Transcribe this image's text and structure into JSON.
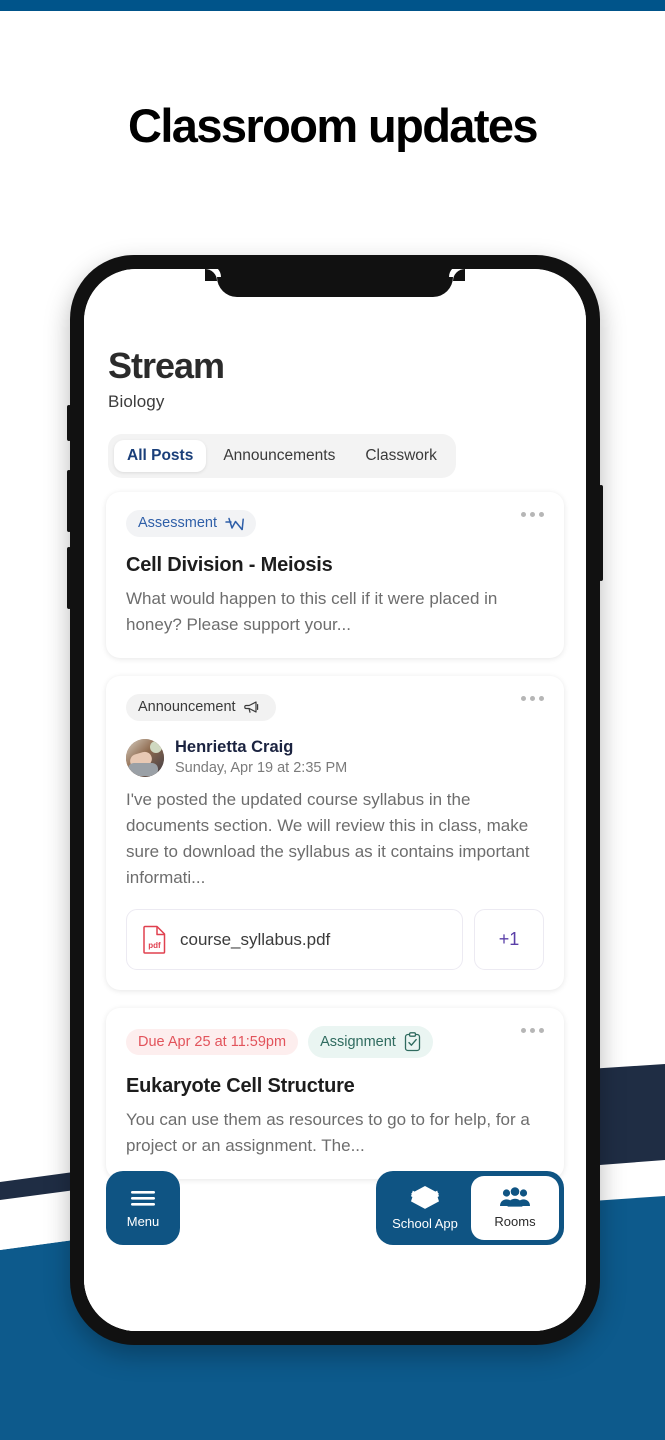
{
  "page": {
    "title": "Classroom updates",
    "top_strip_color": "#00548a",
    "bg_blue": "#0d5a8c",
    "bg_navy": "#1f2d44"
  },
  "app": {
    "header": {
      "title": "Stream",
      "subtitle": "Biology"
    },
    "tabs": [
      {
        "label": "All Posts",
        "active": true
      },
      {
        "label": "Announcements",
        "active": false
      },
      {
        "label": "Classwork",
        "active": false
      }
    ],
    "posts": [
      {
        "badge": {
          "label": "Assessment",
          "icon": "trend-chart-icon",
          "color": "#2f5fa8"
        },
        "menu_icon": "more-options-icon",
        "title": "Cell Division - Meiosis",
        "body": "What would happen to this cell if it were placed in honey? Please support your..."
      },
      {
        "badge": {
          "label": "Announcement",
          "icon": "megaphone-icon",
          "color": "#3a3a3a"
        },
        "menu_icon": "more-options-icon",
        "author": {
          "name": "Henrietta Craig",
          "timestamp": "Sunday, Apr 19 at 2:35 PM",
          "avatar": "user-avatar"
        },
        "body": "I've posted the updated course syllabus in the documents section. We will review this in class, make sure to download the syllabus as it contains important informati...",
        "attachments": [
          {
            "filename": "course_syllabus.pdf",
            "filetype": "pdf",
            "icon": "pdf-file-icon"
          }
        ],
        "more_attachments_label": "+1"
      },
      {
        "due_pill": {
          "label": "Due Apr 25 at 11:59pm",
          "color": "#e2535b"
        },
        "badge": {
          "label": "Assignment",
          "icon": "clipboard-check-icon",
          "color": "#2f6b5f"
        },
        "menu_icon": "more-options-icon",
        "title": "Eukaryote Cell Structure",
        "body": "You can use them as resources to go to for help, for a project or an assignment. The..."
      }
    ],
    "bottom_bar": {
      "menu": {
        "label": "Menu",
        "icon": "hamburger-menu-icon"
      },
      "items": [
        {
          "label": "School App",
          "icon": "layers-stack-icon",
          "active": false
        },
        {
          "label": "Rooms",
          "icon": "people-group-icon",
          "active": true
        }
      ]
    }
  }
}
